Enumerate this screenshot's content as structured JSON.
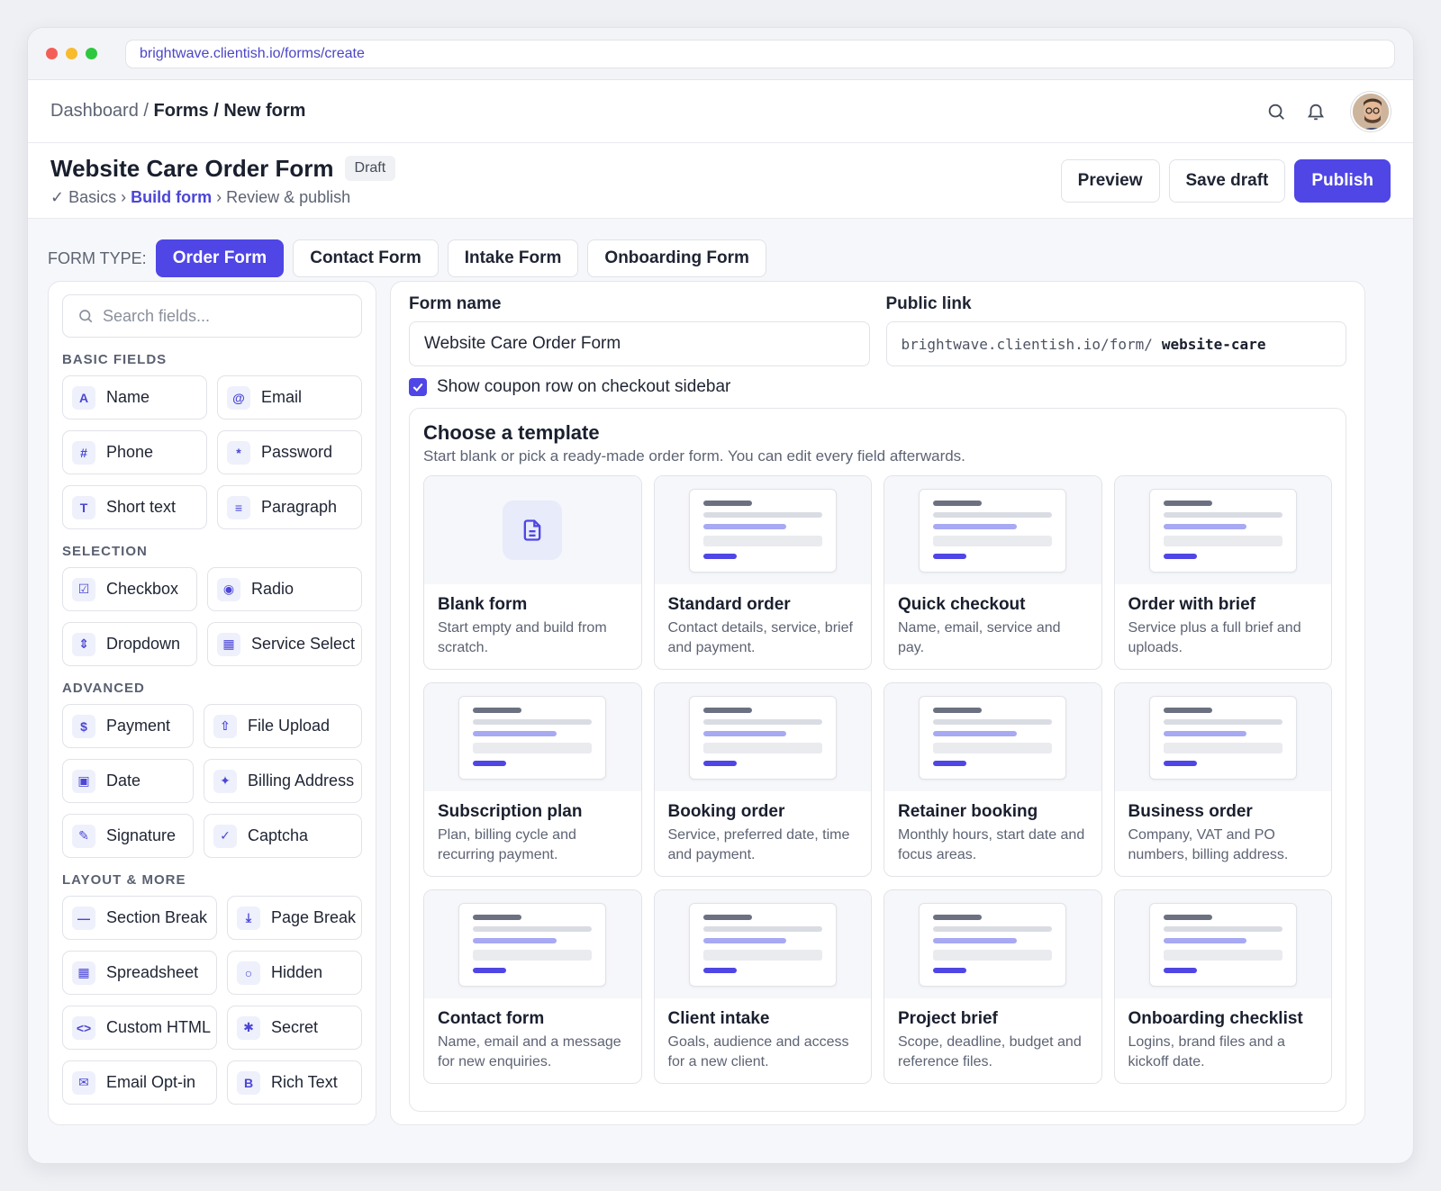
{
  "browser": {
    "url": "brightwave.clientish.io/forms/create"
  },
  "nav": {
    "crumb_dashboard": "Dashboard",
    "crumb_sep1": " / ",
    "crumb_forms": "Forms",
    "crumb_sep2": " / ",
    "crumb_new": "New form"
  },
  "header": {
    "title": "Website Care Order Form",
    "badge": "Draft",
    "step1": "✓ Basics",
    "sep1": " › ",
    "step2": "Build form",
    "sep2": " › ",
    "step3": "Review & publish",
    "preview": "Preview",
    "save_draft": "Save draft",
    "publish": "Publish"
  },
  "form_type": {
    "label": "FORM TYPE:",
    "tabs": [
      "Order Form",
      "Contact Form",
      "Intake Form",
      "Onboarding Form"
    ]
  },
  "sidebar": {
    "search_placeholder": "Search fields...",
    "basic_title": "BASIC FIELDS",
    "basic": [
      {
        "icon": "A",
        "label": "Name"
      },
      {
        "icon": "@",
        "label": "Email"
      },
      {
        "icon": "#",
        "label": "Phone"
      },
      {
        "icon": "*",
        "label": "Password"
      },
      {
        "icon": "T",
        "label": "Short text"
      },
      {
        "icon": "≡",
        "label": "Paragraph"
      }
    ],
    "selection_title": "SELECTION",
    "selection": [
      {
        "icon": "☑",
        "label": "Checkbox"
      },
      {
        "icon": "◉",
        "label": "Radio"
      },
      {
        "icon": "⇕",
        "label": "Dropdown"
      },
      {
        "icon": "▦",
        "label": "Service Select"
      }
    ],
    "advanced_title": "ADVANCED",
    "advanced": [
      {
        "icon": "$",
        "label": "Payment"
      },
      {
        "icon": "⇧",
        "label": "File Upload"
      },
      {
        "icon": "▣",
        "label": "Date"
      },
      {
        "icon": "✦",
        "label": "Billing Address"
      },
      {
        "icon": "✎",
        "label": "Signature"
      },
      {
        "icon": "✓",
        "label": "Captcha"
      }
    ],
    "layout_title": "LAYOUT & MORE",
    "layout": [
      {
        "icon": "—",
        "label": "Section Break"
      },
      {
        "icon": "⤓",
        "label": "Page Break"
      },
      {
        "icon": "▦",
        "label": "Spreadsheet"
      },
      {
        "icon": "○",
        "label": "Hidden"
      },
      {
        "icon": "<>",
        "label": "Custom HTML"
      },
      {
        "icon": "✱",
        "label": "Secret"
      },
      {
        "icon": "✉",
        "label": "Email Opt-in"
      },
      {
        "icon": "B",
        "label": "Rich Text"
      }
    ]
  },
  "main": {
    "form_name_label": "Form name",
    "form_name_value": "Website Care Order Form",
    "public_link_label": "Public link",
    "public_link_prefix": "brightwave.clientish.io/form/",
    "public_link_slug": "website-care",
    "coupon_label": "Show coupon row on checkout sidebar",
    "coupon_checked": true,
    "templates_title": "Choose a template",
    "templates_subtitle": "Start blank or pick a ready-made order form. You can edit every field afterwards.",
    "templates": [
      {
        "name": "Blank form",
        "desc": "Start empty and build from scratch."
      },
      {
        "name": "Standard order",
        "desc": "Contact details, service, brief and payment."
      },
      {
        "name": "Quick checkout",
        "desc": "Name, email, service and pay."
      },
      {
        "name": "Order with brief",
        "desc": "Service plus a full brief and uploads."
      },
      {
        "name": "Subscription plan",
        "desc": "Plan, billing cycle and recurring payment."
      },
      {
        "name": "Booking order",
        "desc": "Service, preferred date, time and payment."
      },
      {
        "name": "Retainer booking",
        "desc": "Monthly hours, start date and focus areas."
      },
      {
        "name": "Business order",
        "desc": "Company, VAT and PO numbers, billing address."
      },
      {
        "name": "Contact form",
        "desc": "Name, email and a message for new enquiries."
      },
      {
        "name": "Client intake",
        "desc": "Goals, audience and access for a new client."
      },
      {
        "name": "Project brief",
        "desc": "Scope, deadline, budget and reference files."
      },
      {
        "name": "Onboarding checklist",
        "desc": "Logins, brand files and a kickoff date."
      }
    ]
  },
  "colors": {
    "accent": "#4f46e5"
  }
}
